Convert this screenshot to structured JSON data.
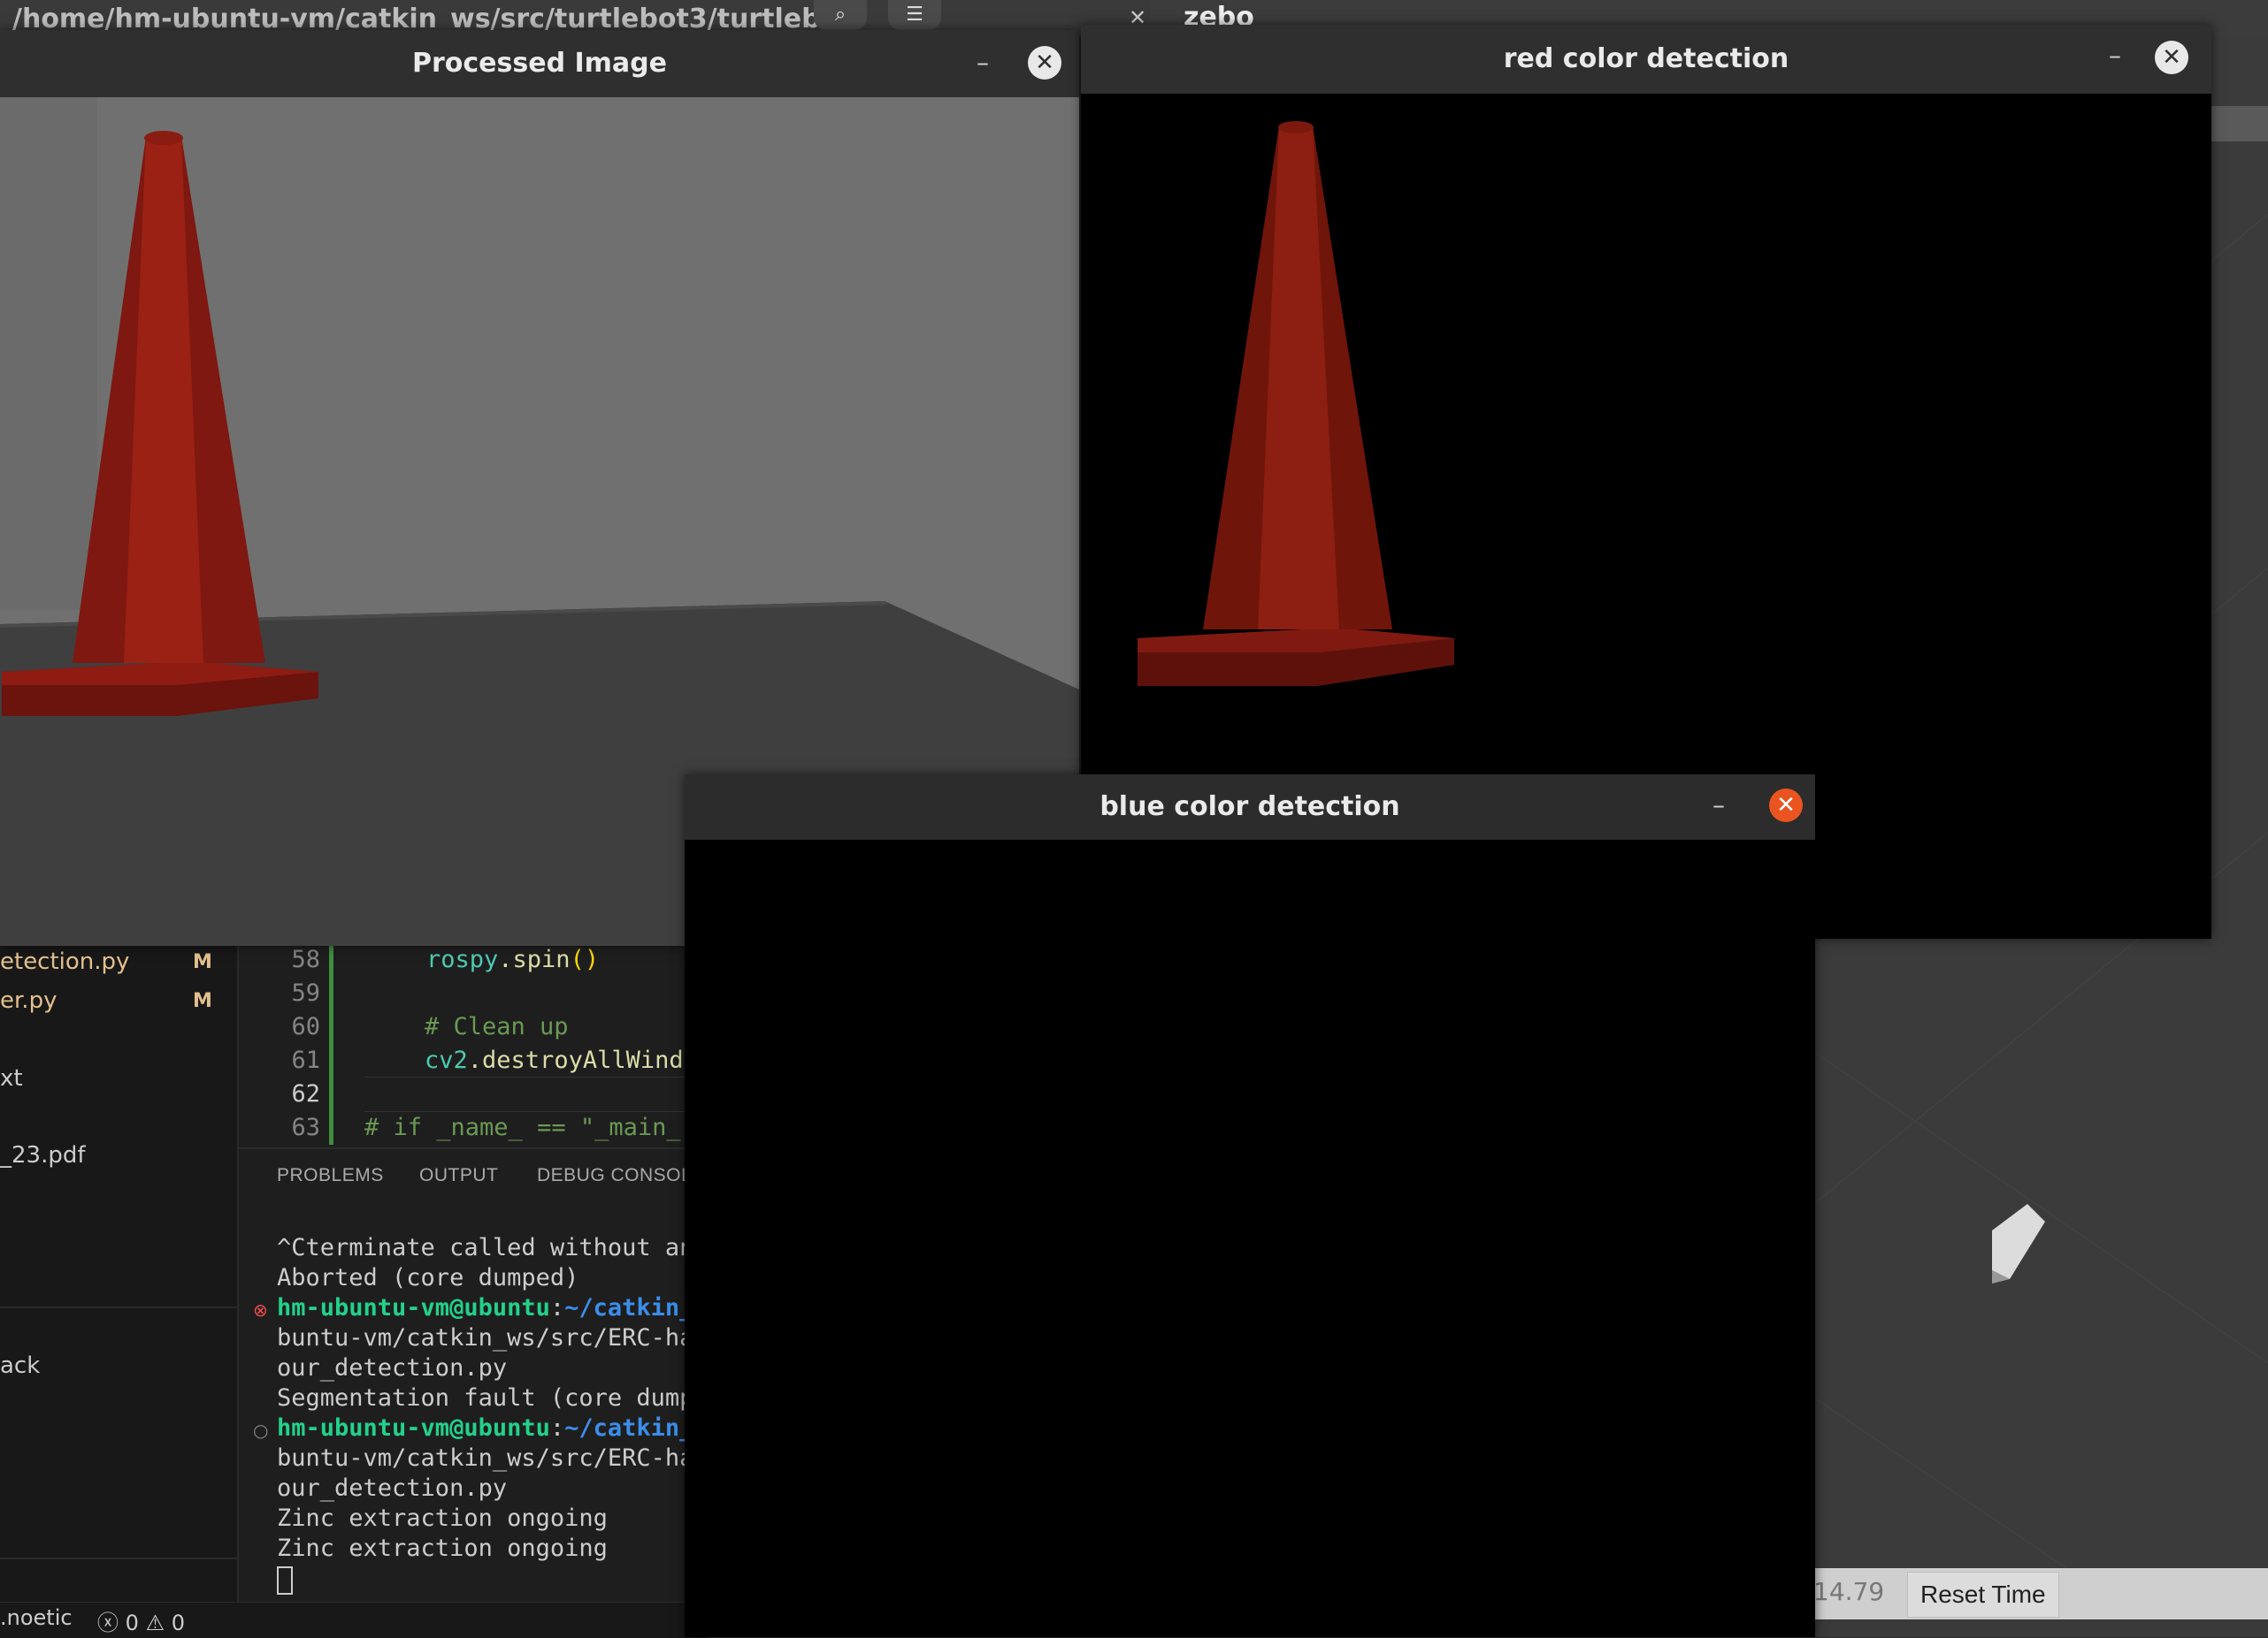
{
  "background_terminal": {
    "title": "/home/hm-ubuntu-vm/catkin_ws/src/turtlebot3/turtlebot",
    "search_icon": "search-icon",
    "menu_icon": "hamburger-menu-icon"
  },
  "gazebo": {
    "title": "zebo",
    "sim_time": "14.79",
    "reset_time_label": "Reset Time"
  },
  "processed_window": {
    "title": "Processed Image",
    "minimize_label": "–",
    "close_label": "✕"
  },
  "red_window": {
    "title": "red color detection",
    "minimize_label": "–",
    "close_label": "✕"
  },
  "blue_window": {
    "title": "blue color detection",
    "minimize_label": "–",
    "close_label": "✕"
  },
  "vscode": {
    "explorer_items": [
      {
        "label": "etection.py",
        "badge": "M"
      },
      {
        "label": "er.py",
        "badge": "M"
      },
      {
        "label": "xt",
        "badge": ""
      },
      {
        "label": "_23.pdf",
        "badge": ""
      },
      {
        "label": "ack",
        "badge": ""
      }
    ],
    "line_numbers": [
      "58",
      "59",
      "60",
      "61",
      "62",
      "63"
    ],
    "code_lines": [
      {
        "obj": "rospy",
        "call": ".spin",
        "paren": "()"
      },
      {
        "text": ""
      },
      {
        "comment": "# Clean up"
      },
      {
        "obj": "cv2",
        "call": ".destroyAllWind"
      },
      {
        "text": ""
      },
      {
        "comment": "# if _name_ == \"_main_"
      }
    ],
    "panel_tabs": [
      "PROBLEMS",
      "OUTPUT",
      "DEBUG CONSOL"
    ],
    "terminal": {
      "line1": "^Cterminate called without an",
      "line2": "Aborted (core dumped)",
      "prompt_user": "hm-ubuntu-vm@ubuntu",
      "prompt_sep": ":",
      "prompt_path": "~/catkin_",
      "line4": "buntu-vm/catkin_ws/src/ERC-ha",
      "line5": "our_detection.py",
      "line6": "Segmentation fault (core dump",
      "line8": "buntu-vm/catkin_ws/src/ERC-ha",
      "line9": "our_detection.py",
      "line10": "Zinc extraction ongoing",
      "line11": "Zinc extraction ongoing"
    },
    "status": {
      "branch": ".noetic",
      "errors": "0",
      "warnings": "0"
    }
  },
  "colors": {
    "cone_red": "#8b1a12",
    "ubuntu_orange": "#e95420",
    "titlebar": "#2f2f2f",
    "git_modified": "#e2c08d"
  }
}
